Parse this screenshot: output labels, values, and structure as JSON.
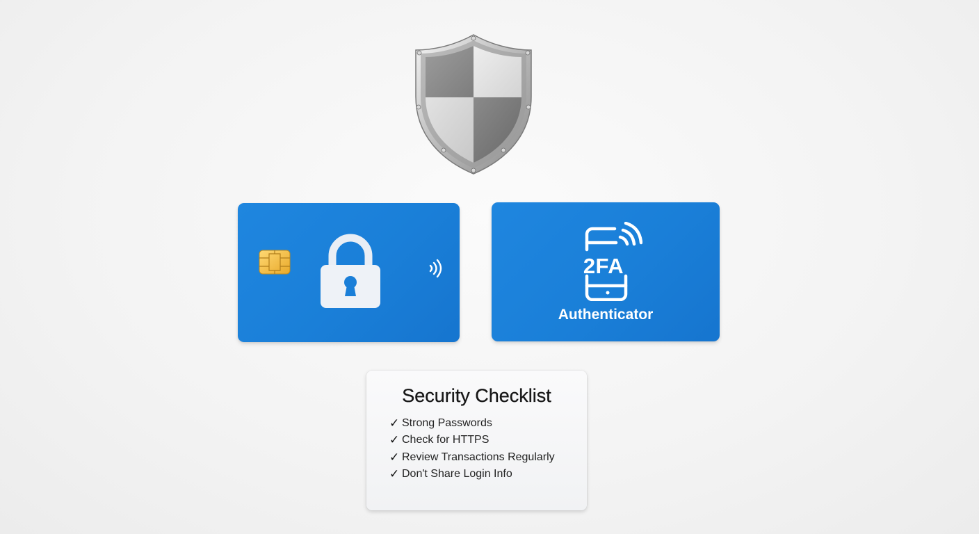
{
  "shield": {
    "icon": "shield-icon"
  },
  "card_lock": {
    "icons": [
      "chip-icon",
      "padlock-icon",
      "contactless-icon"
    ],
    "colors": {
      "card": "#1a7fd8",
      "chip": "#f2b93a",
      "icon": "#ffffff"
    }
  },
  "card_2fa": {
    "label": "2FA",
    "subtitle": "Authenticator",
    "icon": "phone-signal-icon"
  },
  "checklist": {
    "title": "Security Checklist",
    "check_glyph": "✓",
    "items": [
      {
        "label": "Strong Passwords"
      },
      {
        "label": "Check for HTTPS"
      },
      {
        "label": "Review Transactions Regularly"
      },
      {
        "label": "Don't Share Login Info"
      }
    ]
  }
}
